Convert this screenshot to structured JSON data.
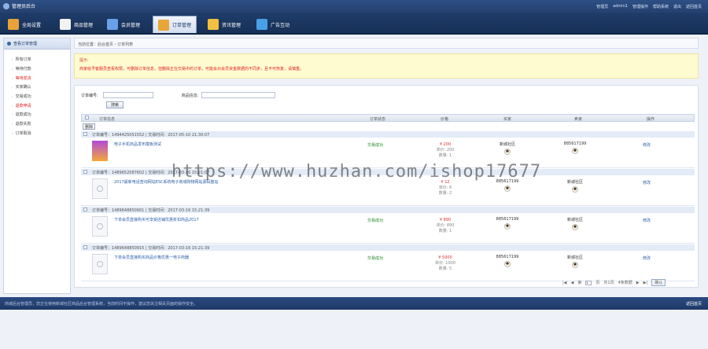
{
  "header": {
    "title": "管理员后台",
    "right_links": [
      "管理员",
      "admin1",
      "管理操作",
      "帮助系统",
      "退出",
      "返回首页"
    ]
  },
  "nav": {
    "items": [
      {
        "label": "全局设置",
        "icon": "settings-icon",
        "color": "#e8a23a"
      },
      {
        "label": "商品管理",
        "icon": "goods-icon",
        "color": "#f2f2f2"
      },
      {
        "label": "会员管理",
        "icon": "members-icon",
        "color": "#6aa0e8"
      },
      {
        "label": "订单管理",
        "icon": "orders-icon",
        "color": "#e7a637"
      },
      {
        "label": "资讯管理",
        "icon": "news-icon",
        "color": "#f0c040"
      },
      {
        "label": "广告互动",
        "icon": "ads-icon",
        "color": "#4aa0e8"
      }
    ],
    "active_index": 3
  },
  "sidebar": {
    "title": "查看订单管理",
    "items": [
      {
        "label": "所有订单",
        "red": false
      },
      {
        "label": "等待付款",
        "red": false
      },
      {
        "label": "等待发货",
        "red": true
      },
      {
        "label": "买家确认",
        "red": false
      },
      {
        "label": "交易成功",
        "red": false
      },
      {
        "label": "退款申请",
        "red": true
      },
      {
        "label": "退款成功",
        "red": false
      },
      {
        "label": "退款失败",
        "red": false
      },
      {
        "label": "订单取消",
        "red": false
      }
    ]
  },
  "breadcrumb": "当前位置：后台首页 › 订单列表",
  "notice": {
    "title": "提示:",
    "text": "商家给予客服员查看权限，可删除订单信息，但删除正在交易中的订单，可能会对会员资金数据的不同步，且不可恢复，请慎重。"
  },
  "filter": {
    "order_no_label": "订单编号:",
    "goods_label": "商品信息:",
    "search_button": "搜索"
  },
  "table": {
    "columns": [
      "订单信息",
      "订单状态",
      "价格",
      "买家",
      "卖家",
      "操作"
    ],
    "delete_button": "删除"
  },
  "orders": [
    {
      "meta": "订单编号：1494425051552 | 交易时间：2017-05-10 21:30:07",
      "name": "电子手机商品发布模板测试",
      "thumb": "promo",
      "status": "交易成功",
      "price": "¥ 200",
      "unit": "单价: 200",
      "qty": "数量: 1",
      "buyer": "新城社区",
      "seller": "885617199",
      "op": "修改"
    },
    {
      "meta": "订单编号：1489652087602 | 交易时间：2017-03-16 15:21:07",
      "name": "2017最新电话查询网站ESC系统电子商城购物网站源码整站",
      "thumb": "none",
      "status": "",
      "price": "¥ 12",
      "unit": "单价: 6",
      "qty": "数量: 2",
      "buyer": "885617199",
      "seller": "新城社区",
      "op": "修改"
    },
    {
      "meta": "订单编号：1489648850901 | 交易时间：2017-03-16 15:21:39",
      "name": "下单会员直接购买可享受店铺优惠折扣商品2017",
      "thumb": "none",
      "status": "交易成功",
      "price": "¥ 890",
      "unit": "单价: 890",
      "qty": "数量: 1",
      "buyer": "885617199",
      "seller": "新城社区",
      "op": "修改"
    },
    {
      "meta": "订单编号：1489648850915 | 交易时间：2017-03-16 15:21:39",
      "name": "下单会员直接购买商品价格优惠一电子商器",
      "thumb": "none",
      "status": "交易成功",
      "price": "¥ 5000",
      "unit": "单价: 1000",
      "qty": "数量: 5",
      "buyer": "885617199",
      "seller": "新城社区",
      "op": "修改"
    }
  ],
  "pager": {
    "first": "|◀",
    "prev": "◀",
    "page_label_pre": "第",
    "page_value": "1",
    "page_label_post": "页",
    "total": "共1页",
    "count": "4条数据",
    "next": "▶",
    "last": "▶|",
    "go": "确认"
  },
  "footer": {
    "left": "商城后台管理员，您正在使用新城社区商品后台管理系统，当前时间不操作，建议您关注相关页面的操作安全。",
    "right": "返回首页"
  },
  "watermark": "https://www.huzhan.com/ishop17677"
}
